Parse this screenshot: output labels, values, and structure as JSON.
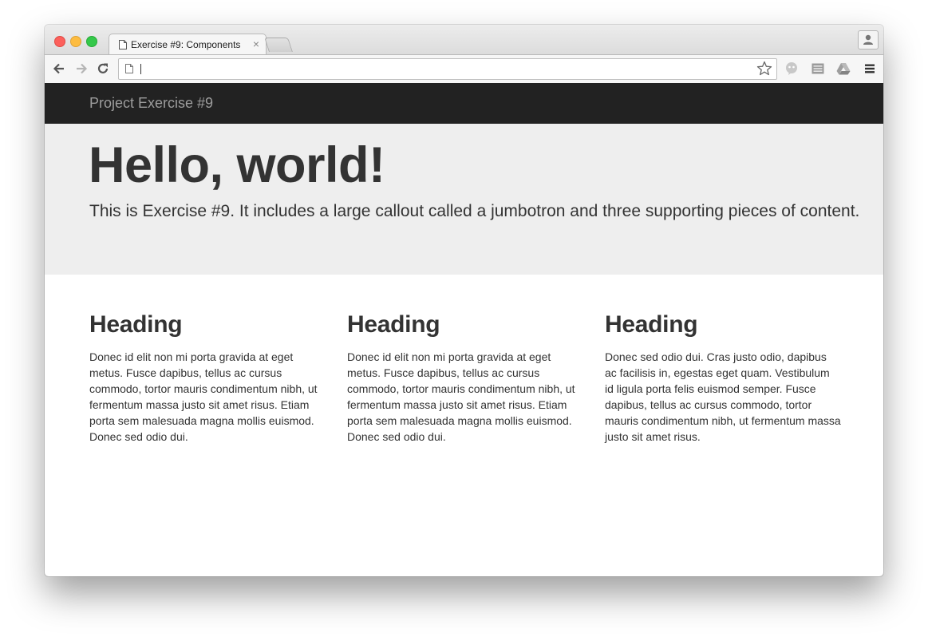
{
  "browser": {
    "tab_title": "Exercise #9: Components",
    "tab_close": "×",
    "address_value": "",
    "icons": {
      "back": "back-arrow-icon",
      "forward": "forward-arrow-icon",
      "reload": "reload-icon",
      "bookmark": "star-icon",
      "menu": "hamburger-menu-icon"
    }
  },
  "navbar": {
    "brand": "Project Exercise #9"
  },
  "jumbotron": {
    "title": "Hello, world!",
    "lead": "This is Exercise #9. It includes a large callout called a jumbotron and three supporting pieces of content."
  },
  "columns": [
    {
      "heading": "Heading",
      "body": "Donec id elit non mi porta gravida at eget metus. Fusce dapibus, tellus ac cursus commodo, tortor mauris condimentum nibh, ut fermentum massa justo sit amet risus. Etiam porta sem malesuada magna mollis euismod. Donec sed odio dui."
    },
    {
      "heading": "Heading",
      "body": "Donec id elit non mi porta gravida at eget metus. Fusce dapibus, tellus ac cursus commodo, tortor mauris condimentum nibh, ut fermentum massa justo sit amet risus. Etiam porta sem malesuada magna mollis euismod. Donec sed odio dui."
    },
    {
      "heading": "Heading",
      "body": "Donec sed odio dui. Cras justo odio, dapibus ac facilisis in, egestas eget quam. Vestibulum id ligula porta felis euismod semper. Fusce dapibus, tellus ac cursus commodo, tortor mauris condimentum nibh, ut fermentum massa justo sit amet risus."
    }
  ],
  "colors": {
    "navbar_bg": "#222222",
    "brand_text": "#9d9d9d",
    "jumbotron_bg": "#eeeeee",
    "text": "#333333"
  }
}
